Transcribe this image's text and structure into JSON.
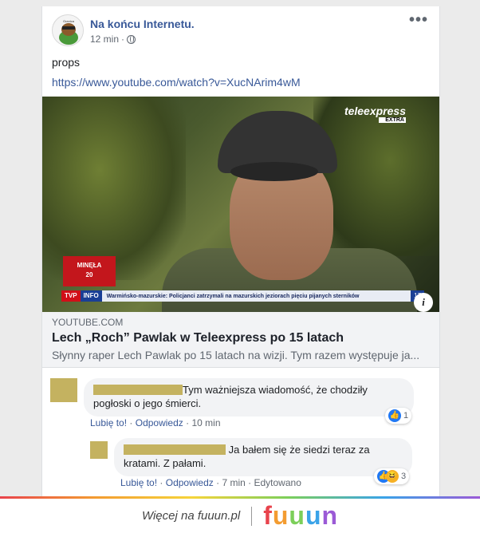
{
  "post": {
    "author": "Na końcu Internetu.",
    "time": "12 min",
    "separator": "·",
    "text": "props",
    "url": "https://www.youtube.com/watch?v=XucNArim4wM"
  },
  "video": {
    "brand": "teleexpress",
    "brand_sub": "EXTRA",
    "minela_label": "MINĘŁA",
    "minela_value": "20",
    "tvp": "TVP",
    "info": "INFO",
    "ticker_text": "Warmińsko-mazurskie: Policjanci zatrzymali na mazurskich jeziorach pięciu pijanych sterników",
    "ticker_num": "17",
    "info_button": "i"
  },
  "preview": {
    "domain": "YOUTUBE.COM",
    "title": "Lech „Roch” Pawlak w Teleexpress po 15 latach",
    "description": "Słynny raper Lech Pawlak po 15 latach na wizji. Tym razem występuje ja..."
  },
  "comments": [
    {
      "text": "Tym ważniejsza wiadomość, że chodziły pogłoski o jego śmierci.",
      "text_line1": "Tym ważniejsza wiadomość, że chodziły",
      "text_line2": "pogłoski o jego śmierci.",
      "like": "Lubię to!",
      "reply": "Odpowiedz",
      "time": "10 min",
      "reactions": "1"
    },
    {
      "text": "Ja bałem się że siedzi teraz za kratami. Z pałami.",
      "text_line1": "Ja bałem się że siedzi teraz za",
      "text_line2": "kratami. Z pałami.",
      "like": "Lubię to!",
      "reply": "Odpowiedz",
      "time": "7 min",
      "edited": "Edytowano",
      "reactions": "3"
    }
  ],
  "footer": {
    "more": "Więcej na fuuun.pl",
    "logo": [
      "f",
      "u",
      "u",
      "u",
      "n"
    ]
  },
  "colors": {
    "link": "#385898",
    "redaction": "#c4b260",
    "like": "#2078f4"
  }
}
